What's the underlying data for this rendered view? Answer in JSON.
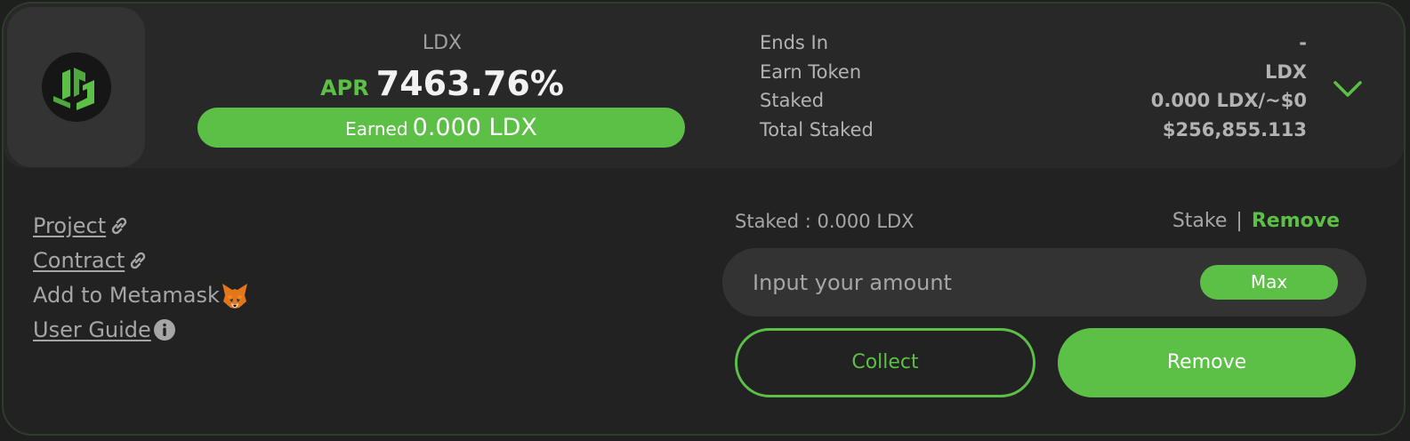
{
  "colors": {
    "accent": "#5cbf46",
    "card_bg": "#222222",
    "header_bg": "#282828",
    "muted_text": "#a6a6a6",
    "input_bg": "#333333"
  },
  "header": {
    "logo_icon": "ldx-logo-icon",
    "token_name": "LDX",
    "apr_label": "APR",
    "apr_value": "7463.76%",
    "earned_label": "Earned",
    "earned_value": "0.000 LDX",
    "stats": [
      {
        "label": "Ends In",
        "value": "-"
      },
      {
        "label": "Earn Token",
        "value": "LDX"
      },
      {
        "label": "Staked",
        "value": "0.000 LDX/~$0"
      },
      {
        "label": "Total Staked",
        "value": "$256,855.113"
      }
    ],
    "expand_icon": "chevron-down-icon"
  },
  "links": {
    "project": "Project",
    "contract": "Contract",
    "add_metamask": "Add to Metamask",
    "user_guide": "User Guide"
  },
  "stake_panel": {
    "staked_label": "Staked : 0.000 LDX",
    "mode_stake": "Stake",
    "mode_separator": "|",
    "mode_remove": "Remove",
    "input_placeholder": "Input your amount",
    "max_label": "Max",
    "collect_label": "Collect",
    "remove_label": "Remove"
  }
}
